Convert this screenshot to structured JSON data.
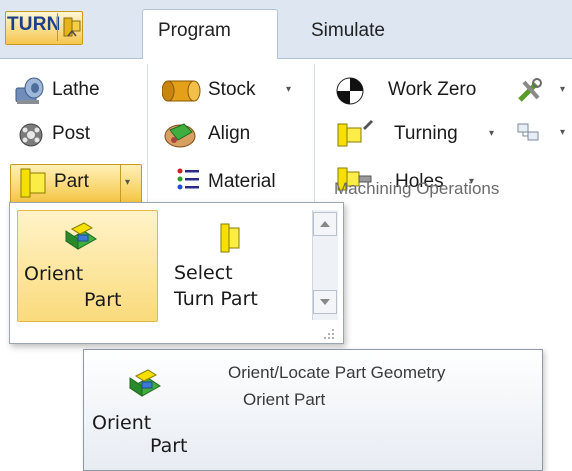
{
  "tabs": {
    "mode_label": "TURN",
    "program": "Program",
    "simulate": "Simulate"
  },
  "ribbon": {
    "setup": {
      "lathe": "Lathe",
      "post": "Post",
      "part": "Part"
    },
    "stock_group": {
      "stock": "Stock",
      "align": "Align",
      "material": "Material"
    },
    "machining": {
      "work_zero": "Work Zero",
      "turning": "Turning",
      "holes": "Holes",
      "group_label": "Machining Operations"
    },
    "dropdown_arrow": "▾"
  },
  "dropdown": {
    "items": [
      {
        "line1": "Orient",
        "line2": "Part"
      },
      {
        "line1": "Select",
        "line2": "Turn Part"
      }
    ]
  },
  "tooltip": {
    "title": "Orient/Locate Part Geometry",
    "subtitle": "Orient Part",
    "big_line1": "Orient",
    "big_line2": "Part"
  },
  "colors": {
    "accent_gold": "#f5c542",
    "tab_strip": "#dde6f1",
    "part_icon": "#f7e000"
  },
  "icons": [
    "lathe-icon",
    "post-icon",
    "part-icon",
    "stock-icon",
    "align-icon",
    "material-icon",
    "work-zero-icon",
    "tools-icon",
    "turning-icon",
    "clipboard-icon",
    "holes-icon",
    "orient-part-icon",
    "select-turn-part-icon"
  ]
}
